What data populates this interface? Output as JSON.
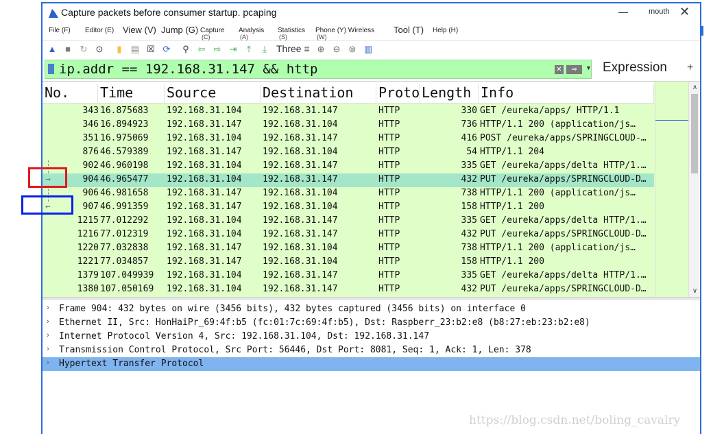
{
  "window": {
    "title": "Capture packets before consumer startup. pcaping",
    "user": "mouth",
    "minimize_glyph": "—",
    "close_glyph": "✕"
  },
  "menu": [
    {
      "label": "File (F)",
      "style": "small"
    },
    {
      "label": "Editor (E)",
      "style": "small"
    },
    {
      "label": "View (V)",
      "style": "big"
    },
    {
      "label": "Jump (G)",
      "style": "big"
    },
    {
      "label": "Capture",
      "accel": "(C)",
      "style": "small"
    },
    {
      "label": "Analysis",
      "accel": "(A)",
      "style": "small"
    },
    {
      "label": "Statistics",
      "accel": "(S)",
      "style": "small"
    },
    {
      "label": "Phone (Y) Wireless",
      "accel": "(W)",
      "style": "small"
    },
    {
      "label": "Tool (T)",
      "style": "big"
    },
    {
      "label": "Help (H)",
      "style": "small"
    }
  ],
  "toolbar": {
    "icons": [
      "shark-fin-start-icon",
      "stop-icon",
      "restart-icon",
      "options-icon",
      "open-file-icon",
      "save-file-icon",
      "close-file-icon",
      "reload-icon",
      "find-icon",
      "back-icon",
      "forward-icon",
      "goto-icon",
      "first-icon",
      "last-icon"
    ],
    "text_item": "Three ≡",
    "icons_after": [
      "zoom-in-icon",
      "zoom-out-icon",
      "zoom-normal-icon",
      "resize-columns-icon"
    ]
  },
  "filter": {
    "value": "ip.addr == 192.168.31.147 && http",
    "clear_glyph": "✕",
    "apply_glyph": "⇒",
    "expression_label": "Expression",
    "add_glyph": "+"
  },
  "columns": [
    "No.",
    "Time",
    "Source",
    "Destination",
    "Protocol",
    "Length",
    "Info"
  ],
  "packets": [
    {
      "no": "343",
      "time": "16.875683",
      "src": "192.168.31.104",
      "dst": "192.168.31.147",
      "proto": "HTTP",
      "len": "330",
      "info": "GET /eureka/apps/ HTTP/1.1"
    },
    {
      "no": "346",
      "time": "16.894923",
      "src": "192.168.31.147",
      "dst": "192.168.31.104",
      "proto": "HTTP",
      "len": "736",
      "info": "HTTP/1.1 200   (application/js…"
    },
    {
      "no": "351",
      "time": "16.975069",
      "src": "192.168.31.104",
      "dst": "192.168.31.147",
      "proto": "HTTP",
      "len": "416",
      "info": "POST /eureka/apps/SPRINGCLOUD-…"
    },
    {
      "no": "876",
      "time": "46.579389",
      "src": "192.168.31.147",
      "dst": "192.168.31.104",
      "proto": "HTTP",
      "len": "54",
      "info": "HTTP/1.1 204"
    },
    {
      "no": "902",
      "time": "46.960198",
      "src": "192.168.31.104",
      "dst": "192.168.31.147",
      "proto": "HTTP",
      "len": "335",
      "info": "GET /eureka/apps/delta HTTP/1.…"
    },
    {
      "no": "904",
      "time": "46.965477",
      "src": "192.168.31.104",
      "dst": "192.168.31.147",
      "proto": "HTTP",
      "len": "432",
      "info": "PUT /eureka/apps/SPRINGCLOUD-D…",
      "selected": true,
      "marker": "→"
    },
    {
      "no": "906",
      "time": "46.981658",
      "src": "192.168.31.147",
      "dst": "192.168.31.104",
      "proto": "HTTP",
      "len": "738",
      "info": "HTTP/1.1 200   (application/js…"
    },
    {
      "no": "907",
      "time": "46.991359",
      "src": "192.168.31.147",
      "dst": "192.168.31.104",
      "proto": "HTTP",
      "len": "158",
      "info": "HTTP/1.1 200",
      "marker": "←"
    },
    {
      "no": "1215",
      "time": "77.012292",
      "src": "192.168.31.104",
      "dst": "192.168.31.147",
      "proto": "HTTP",
      "len": "335",
      "info": "GET /eureka/apps/delta HTTP/1.…"
    },
    {
      "no": "1216",
      "time": "77.012319",
      "src": "192.168.31.104",
      "dst": "192.168.31.147",
      "proto": "HTTP",
      "len": "432",
      "info": "PUT /eureka/apps/SPRINGCLOUD-D…"
    },
    {
      "no": "1220",
      "time": "77.032838",
      "src": "192.168.31.147",
      "dst": "192.168.31.104",
      "proto": "HTTP",
      "len": "738",
      "info": "HTTP/1.1 200   (application/js…"
    },
    {
      "no": "1221",
      "time": "77.034857",
      "src": "192.168.31.147",
      "dst": "192.168.31.104",
      "proto": "HTTP",
      "len": "158",
      "info": "HTTP/1.1 200"
    },
    {
      "no": "1379",
      "time": "107.049939",
      "src": "192.168.31.104",
      "dst": "192.168.31.147",
      "proto": "HTTP",
      "len": "335",
      "info": "GET /eureka/apps/delta HTTP/1.…"
    },
    {
      "no": "1380",
      "time": "107.050169",
      "src": "192.168.31.104",
      "dst": "192.168.31.147",
      "proto": "HTTP",
      "len": "432",
      "info": "PUT /eureka/apps/SPRINGCLOUD-D…"
    }
  ],
  "details": [
    {
      "text": "Frame 904: 432 bytes on wire (3456 bits), 432 bytes captured (3456 bits) on interface 0"
    },
    {
      "text": "Ethernet II, Src: HonHaiPr_69:4f:b5 (fc:01:7c:69:4f:b5), Dst: Raspberr_23:b2:e8 (b8:27:eb:23:b2:e8)"
    },
    {
      "text": "Internet Protocol Version 4, Src: 192.168.31.104, Dst: 192.168.31.147"
    },
    {
      "text": "Transmission Control Protocol, Src Port: 56446, Dst Port: 8081, Seq: 1, Ack: 1, Len: 378"
    },
    {
      "text": "Hypertext Transfer Protocol",
      "highlighted": true
    }
  ],
  "scroll": {
    "up_glyph": "∧",
    "down_glyph": "∨"
  },
  "watermark": "https://blog.csdn.net/boling_cavalry",
  "colors": {
    "packet_bg": "#e0ffc8",
    "selected_row": "#a3e6c8",
    "filter_bg": "#afffaf",
    "detail_highlight": "#80b4f0",
    "red_marker": "#e0191f",
    "blue_marker": "#0a1ee6"
  }
}
